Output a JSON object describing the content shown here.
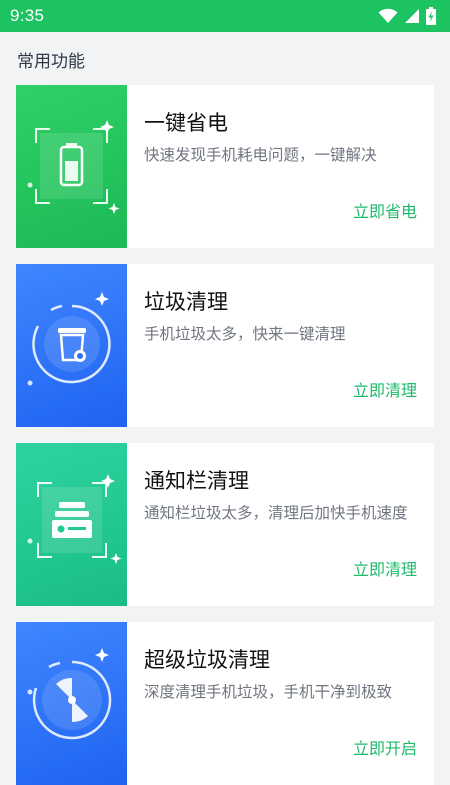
{
  "status_bar": {
    "time": "9:35"
  },
  "section_title": "常用功能",
  "cards": [
    {
      "title": "一键省电",
      "desc": "快速发现手机耗电问题，一键解决",
      "action": "立即省电"
    },
    {
      "title": "垃圾清理",
      "desc": "手机垃圾太多，快来一键清理",
      "action": "立即清理"
    },
    {
      "title": "通知栏清理",
      "desc": "通知栏垃圾太多，清理后加快手机速度",
      "action": "立即清理"
    },
    {
      "title": "超级垃圾清理",
      "desc": "深度清理手机垃圾，手机干净到极致",
      "action": "立即开启"
    }
  ],
  "colors": {
    "status_bar": "#1ec361",
    "accent_text": "#1fb96a",
    "thumb_green": "#27c75e",
    "thumb_blue": "#2b72f6",
    "thumb_teal": "#22c990"
  },
  "icons": [
    "wifi-icon",
    "signal-icon",
    "battery-charging-icon",
    "battery-icon",
    "trash-bin-icon",
    "notification-icon",
    "disc-icon"
  ]
}
